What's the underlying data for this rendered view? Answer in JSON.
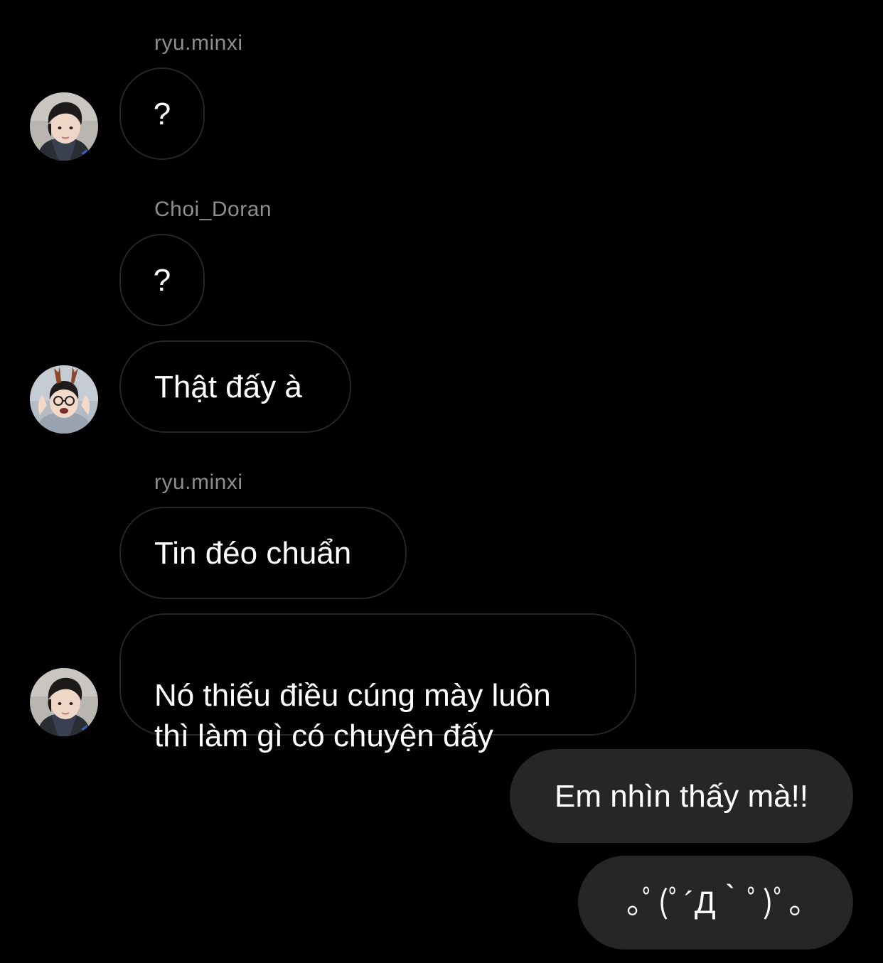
{
  "thread": {
    "messages": [
      {
        "sender": "ryu.minxi",
        "text": "?"
      },
      {
        "sender": "Choi_Doran",
        "text": "?"
      },
      {
        "text": "Thật đấy à"
      },
      {
        "sender": "ryu.minxi",
        "text": "Tin đéo chuẩn"
      },
      {
        "text": "Nó thiếu điều cúng mày luôn\nthì làm gì có chuyện đấy"
      },
      {
        "text": "Em nhìn thấy mà!!"
      },
      {
        "text": "｡ﾟ(ﾟ´Д｀ﾟ)ﾟ｡"
      }
    ]
  },
  "avatars": {
    "ryu_minxi": {
      "name": "ryu-minxi-avatar"
    },
    "choi_doran": {
      "name": "choi-doran-avatar"
    }
  },
  "colors": {
    "background": "#000000",
    "sender_label": "#8e8e8e",
    "bubble_border": "#262626",
    "outgoing_bubble": "#262626",
    "text": "#ffffff"
  }
}
